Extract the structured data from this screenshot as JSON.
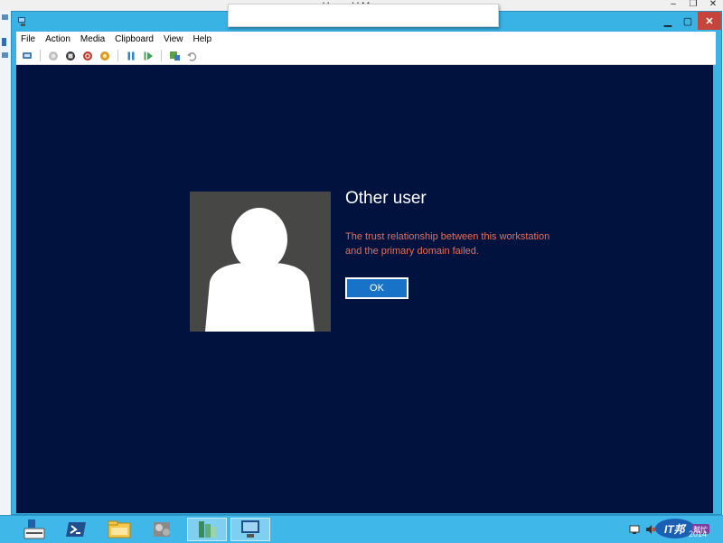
{
  "host": {
    "title": "Hyper-V Manager"
  },
  "menubar": {
    "items": [
      "File",
      "Action",
      "Media",
      "Clipboard",
      "View",
      "Help"
    ]
  },
  "toolbar": {
    "icons": [
      "ctrl-alt-del-icon",
      "start-icon",
      "turn-off-icon",
      "shutdown-icon",
      "save-state-icon",
      "pause-icon",
      "resume-icon",
      "checkpoint-icon",
      "revert-icon"
    ]
  },
  "login": {
    "user_name": "Other user",
    "error_line1": "The trust relationship between this workstation",
    "error_line2": "and the primary domain failed.",
    "ok_label": "OK"
  },
  "taskbar": {
    "apps": [
      "server-manager-icon",
      "powershell-icon",
      "file-explorer-icon",
      "hyper-v-manager-icon",
      "tools-icon",
      "vm-connection-icon"
    ],
    "clock_partial": "2014",
    "watermark": "IT邦 幫忙"
  },
  "colors": {
    "vm_screen": "#01123f",
    "error_text": "#e86f57",
    "ok_button": "#1772c8",
    "chrome": "#39b2e4",
    "close_button": "#c7443c"
  }
}
